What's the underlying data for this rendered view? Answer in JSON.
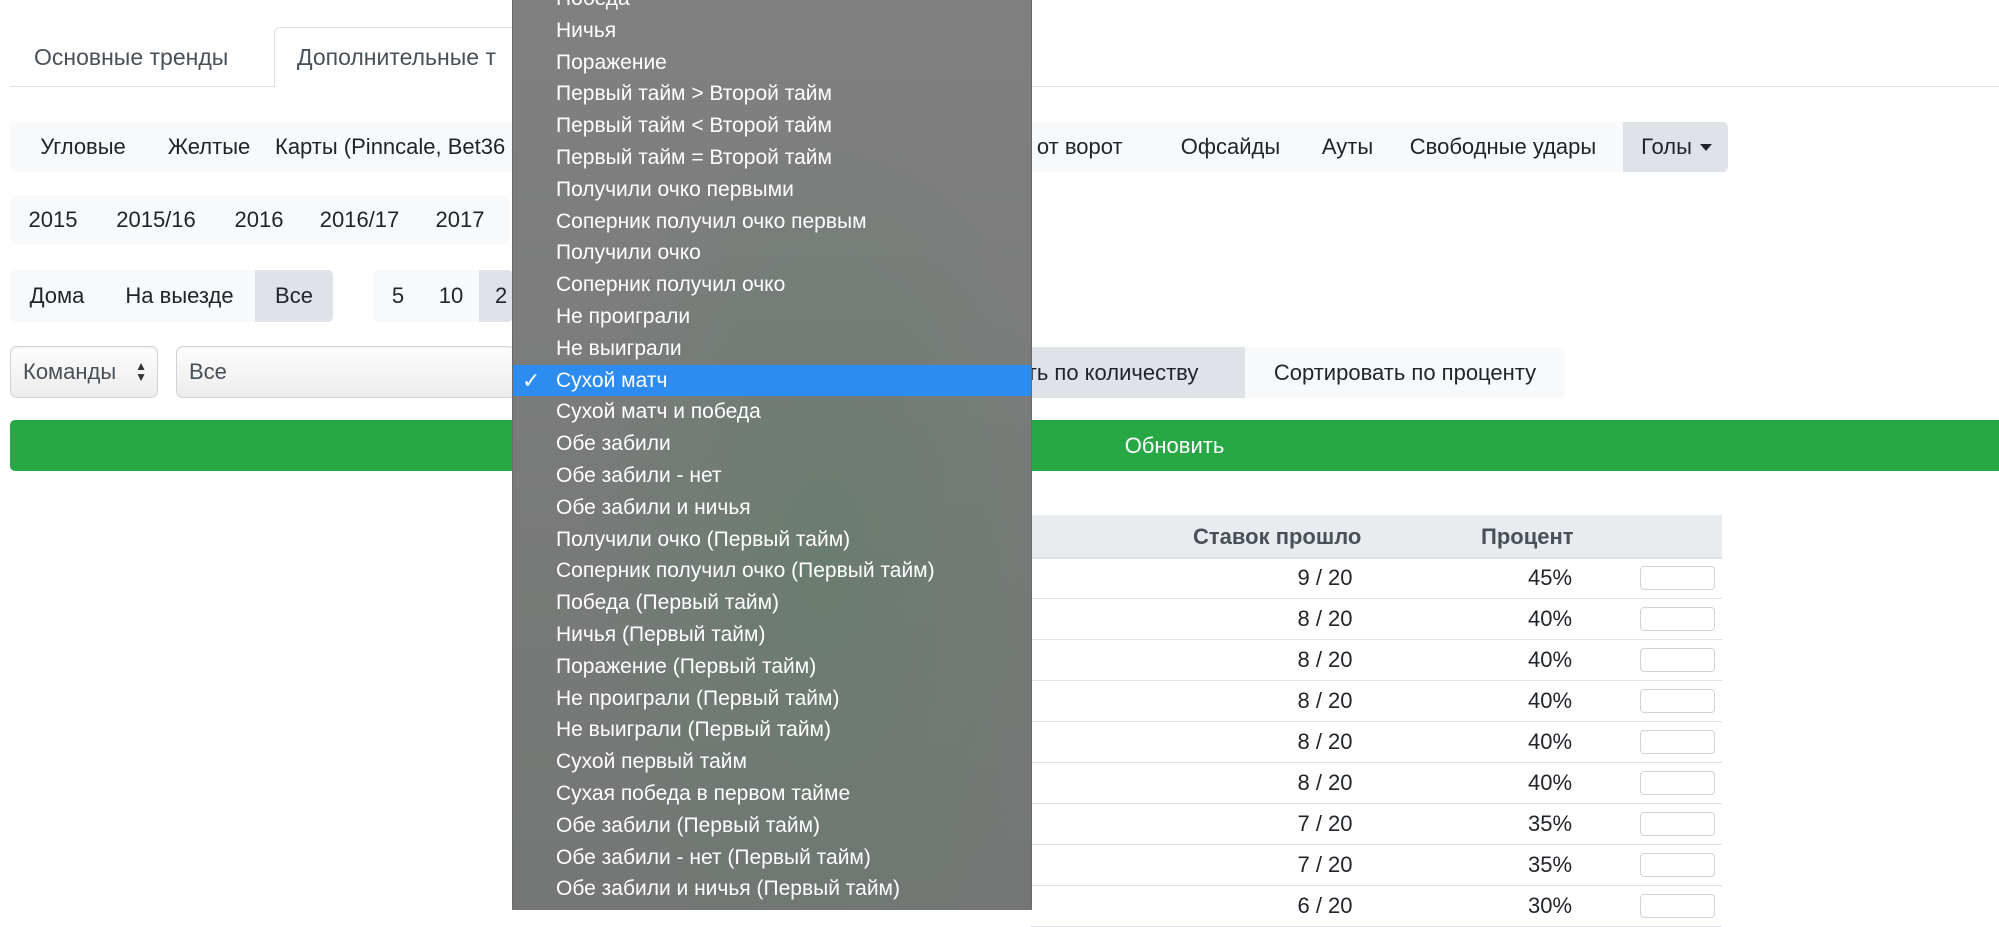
{
  "tabs": {
    "main": "Основные тренды",
    "extra": "Дополнительные т"
  },
  "stat_types": {
    "items": [
      "Угловые",
      "Желтые",
      "Карты (Pinncale, Bet36",
      "ы от ворот",
      "Офсайды",
      "Ауты",
      "Свободные удары"
    ],
    "active": "Голы"
  },
  "seasons": [
    "2015",
    "2015/16",
    "2016",
    "2016/17",
    "2017"
  ],
  "venue": {
    "home": "Дома",
    "away": "На выезде",
    "all": "Все"
  },
  "last_n": [
    "5",
    "10",
    "2"
  ],
  "filters": {
    "teams_select": "Команды",
    "all_select": "Все",
    "sort_by_count": "ать по количеству",
    "sort_by_percent": "Сортировать по проценту"
  },
  "update_button": "Обновить",
  "table": {
    "headers": {
      "bets_passed": "Ставок прошло",
      "percent": "Процент"
    },
    "rows": [
      {
        "bets": "9 / 20",
        "pct": "45%"
      },
      {
        "bets": "8 / 20",
        "pct": "40%"
      },
      {
        "bets": "8 / 20",
        "pct": "40%"
      },
      {
        "bets": "8 / 20",
        "pct": "40%"
      },
      {
        "bets": "8 / 20",
        "pct": "40%"
      },
      {
        "bets": "8 / 20",
        "pct": "40%"
      },
      {
        "bets": "7 / 20",
        "pct": "35%"
      },
      {
        "bets": "7 / 20",
        "pct": "35%"
      },
      {
        "bets": "6 / 20",
        "pct": "30%"
      }
    ]
  },
  "dropdown": {
    "selected": "Сухой матч",
    "options": [
      "Победа",
      "Ничья",
      "Поражение",
      "Первый тайм > Второй тайм",
      "Первый тайм < Второй тайм",
      "Первый тайм = Второй тайм",
      "Получили очко первыми",
      "Соперник получил очко первым",
      "Получили очко",
      "Соперник получил очко",
      "Не проиграли",
      "Не выиграли",
      "Сухой матч",
      "Сухой матч и победа",
      "Обе забили",
      "Обе забили - нет",
      "Обе забили и ничья",
      "Получили очко (Первый тайм)",
      "Соперник получил очко (Первый тайм)",
      "Победа (Первый тайм)",
      "Ничья (Первый тайм)",
      "Поражение (Первый тайм)",
      "Не проиграли (Первый тайм)",
      "Не выиграли (Первый тайм)",
      "Сухой первый тайм",
      "Сухая победа в первом тайме",
      "Обе забили (Первый тайм)",
      "Обе забили - нет (Первый тайм)",
      "Обе забили и ничья (Первый тайм)"
    ]
  },
  "colors": {
    "update_green": "#28a745",
    "selected_blue": "#2d8cf0",
    "menu_gray": "#7f827f"
  }
}
